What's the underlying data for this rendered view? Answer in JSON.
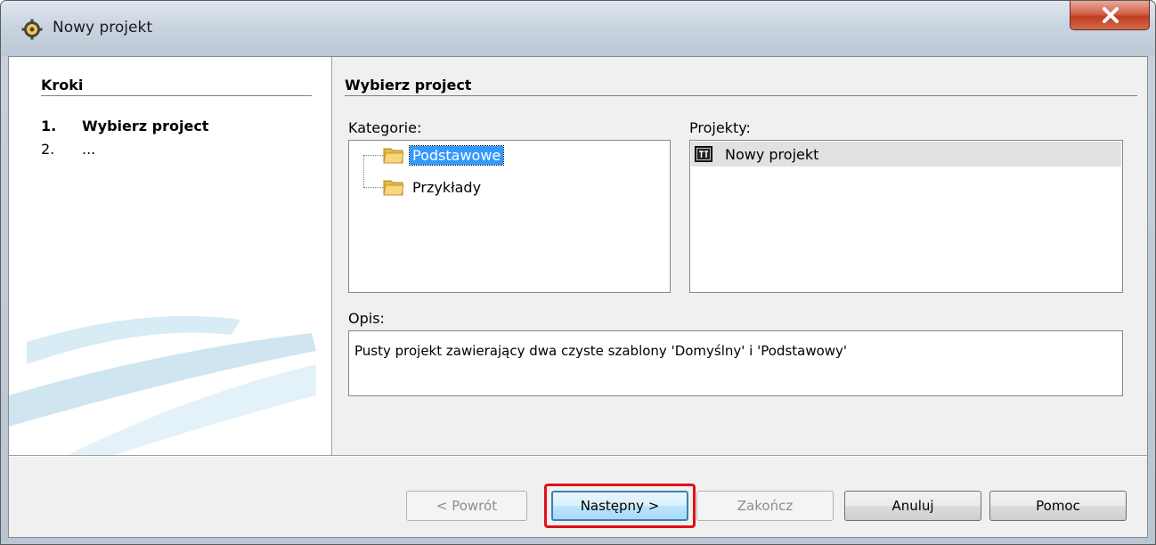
{
  "window": {
    "title": "Nowy projekt"
  },
  "steps": {
    "heading": "Kroki",
    "items": [
      {
        "num": "1.",
        "label": "Wybierz project"
      },
      {
        "num": "2.",
        "label": "..."
      }
    ]
  },
  "main": {
    "heading": "Wybierz project",
    "categories_label": "Kategorie:",
    "categories": [
      "Podstawowe",
      "Przykłady"
    ],
    "projects_label": "Projekty:",
    "projects": [
      "Nowy projekt"
    ],
    "description_label": "Opis:",
    "description": "Pusty projekt zawierający dwa czyste szablony 'Domyślny' i 'Podstawowy'"
  },
  "buttons": {
    "back": "< Powrót",
    "next": "Następny >",
    "finish": "Zakończ",
    "cancel": "Anuluj",
    "help": "Pomoc"
  },
  "colors": {
    "highlight": "#e0101a",
    "selection": "#3399ff"
  },
  "icons": {
    "app": "gear-icon",
    "close": "close-icon",
    "folder": "folder-icon",
    "project": "tsi-project-icon"
  }
}
